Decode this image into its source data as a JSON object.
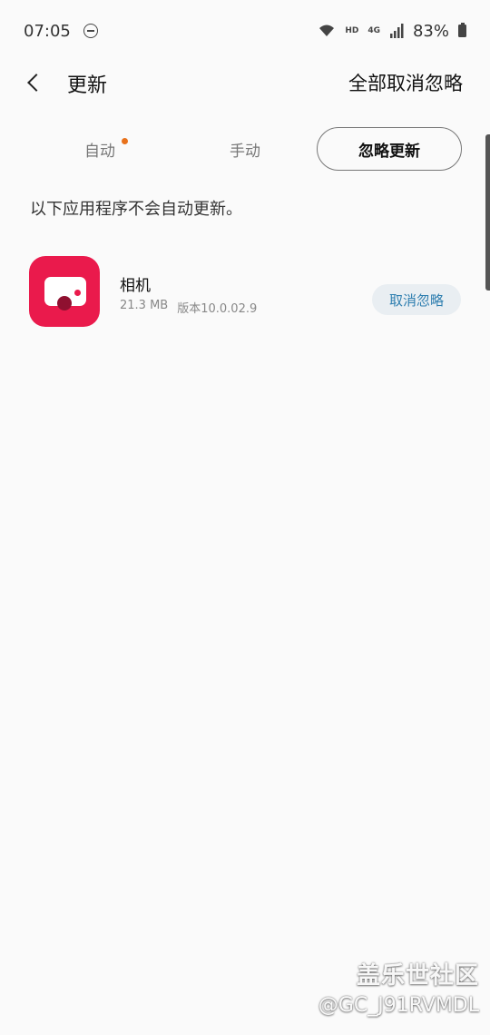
{
  "status_bar": {
    "time": "07:05",
    "hd_label": "HD",
    "network_label": "4G",
    "battery": "83%"
  },
  "app_bar": {
    "title": "更新",
    "action": "全部取消忽略"
  },
  "tabs": [
    {
      "label": "自动",
      "has_badge": true,
      "selected": false
    },
    {
      "label": "手动",
      "selected": false
    },
    {
      "label": "忽略更新",
      "selected": true
    }
  ],
  "info_text": "以下应用程序不会自动更新。",
  "apps": [
    {
      "name": "相机",
      "size": "21.3 MB",
      "version": "版本10.0.02.9",
      "action": "取消忽略",
      "icon": "camera-icon"
    }
  ],
  "watermark": {
    "title": "盖乐世社区",
    "user": "@GC_J91RVMDL"
  },
  "colors": {
    "badge": "#e8711b",
    "app_icon": "#ea1a4c",
    "action_text": "#2f7fb0"
  }
}
